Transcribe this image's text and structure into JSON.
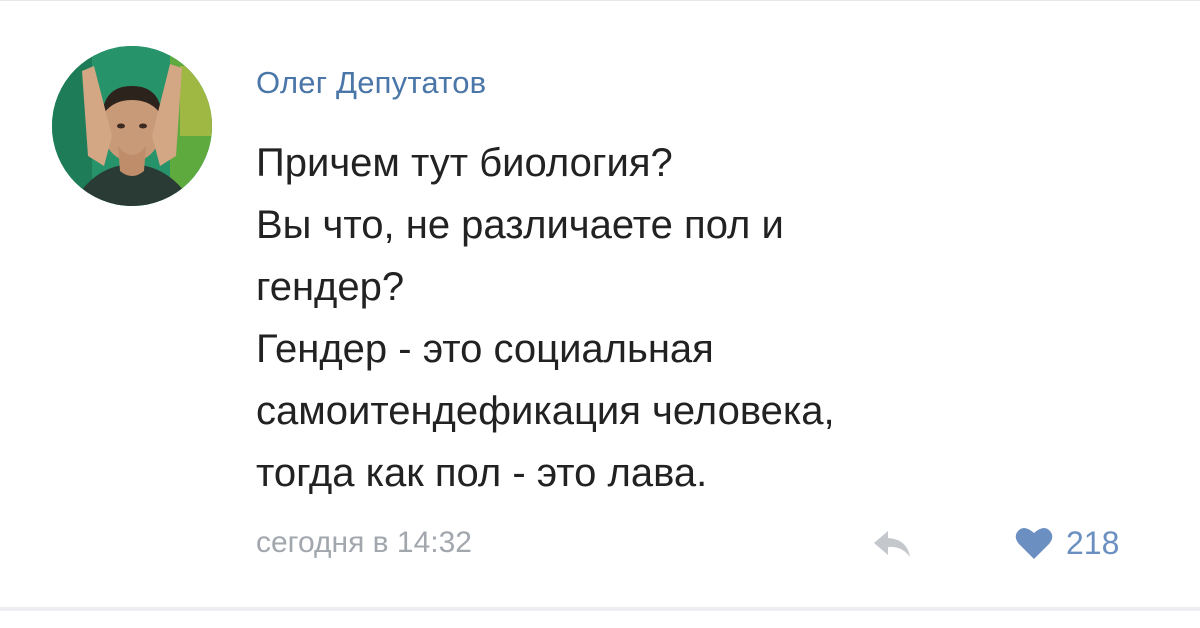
{
  "post": {
    "author": "Олег Депутатов",
    "text_lines": [
      "Причем тут биология?",
      "Вы что, не различаете пол и",
      "гендер?",
      "Гендер - это социальная",
      "самоитендефикация человека,",
      "тогда как пол - это лава."
    ],
    "timestamp": "сегодня в 14:32",
    "likes": "218"
  },
  "icons": {
    "reply": "reply-arrow-icon",
    "like": "heart-icon"
  },
  "colors": {
    "author": "#4a76a8",
    "text": "#222222",
    "timestamp": "#a2a7ae",
    "like": "#6b8fc1",
    "reply_icon": "#c4c8cd"
  }
}
